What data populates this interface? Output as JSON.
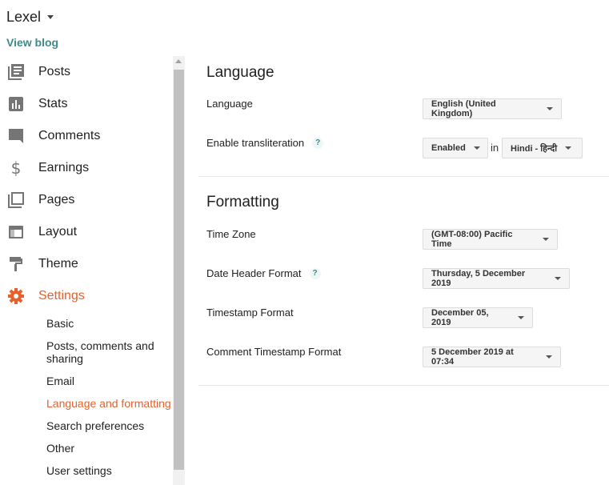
{
  "blog": {
    "name": "Lexel",
    "view_blog": "View blog"
  },
  "sidebar": {
    "items": [
      {
        "label": "Posts",
        "icon": "posts-icon"
      },
      {
        "label": "Stats",
        "icon": "stats-icon"
      },
      {
        "label": "Comments",
        "icon": "comments-icon"
      },
      {
        "label": "Earnings",
        "icon": "dollar-icon"
      },
      {
        "label": "Pages",
        "icon": "pages-icon"
      },
      {
        "label": "Layout",
        "icon": "layout-icon"
      },
      {
        "label": "Theme",
        "icon": "paint-roller-icon"
      },
      {
        "label": "Settings",
        "icon": "gear-icon",
        "active": true
      }
    ],
    "sub_items": [
      {
        "label": "Basic"
      },
      {
        "label": "Posts, comments and sharing"
      },
      {
        "label": "Email"
      },
      {
        "label": "Language and formatting",
        "active": true
      },
      {
        "label": "Search preferences"
      },
      {
        "label": "Other"
      },
      {
        "label": "User settings"
      }
    ]
  },
  "language": {
    "title": "Language",
    "language_label": "Language",
    "language_value": "English (United Kingdom)",
    "transliteration_label": "Enable transliteration",
    "help": "?",
    "transliteration_value": "Enabled",
    "in": "in",
    "transliteration_language": "Hindi - हिन्दी"
  },
  "formatting": {
    "title": "Formatting",
    "time_zone_label": "Time Zone",
    "time_zone_value": "(GMT-08:00) Pacific Time",
    "date_header_label": "Date Header Format",
    "date_header_value": "Thursday, 5 December 2019",
    "timestamp_label": "Timestamp Format",
    "timestamp_value": "December 05, 2019",
    "comment_timestamp_label": "Comment Timestamp Format",
    "comment_timestamp_value": "5 December 2019 at 07:34"
  },
  "colors": {
    "accent": "#e8612c",
    "link": "#3d8a8a",
    "icon": "#757575"
  }
}
